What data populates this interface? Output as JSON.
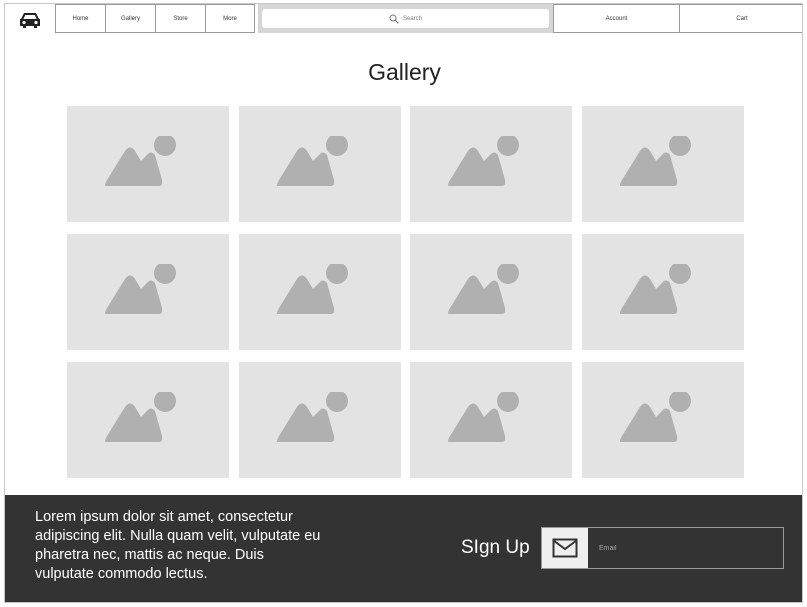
{
  "header": {
    "logo_icon": "car-icon",
    "nav": [
      {
        "label": "Home"
      },
      {
        "label": "Gallery"
      },
      {
        "label": "Store"
      },
      {
        "label": "More"
      }
    ],
    "search": {
      "placeholder": "Search",
      "icon": "search-icon"
    },
    "account_label": "Account",
    "cart_label": "Cart"
  },
  "main": {
    "title": "Gallery",
    "gallery_tile_count": 12,
    "tile_icon": "image-placeholder-icon"
  },
  "footer": {
    "text": "Lorem ipsum dolor sit amet, consectetur adipiscing elit. Nulla quam velit, vulputate eu pharetra nec, mattis ac neque. Duis vulputate commodo lectus.",
    "signup_label": "SIgn Up",
    "email": {
      "placeholder": "Email",
      "icon": "mail-icon"
    }
  },
  "colors": {
    "footer_bg": "#333333",
    "tile_bg": "#e3e3e3",
    "tile_icon": "#b0b0b0"
  }
}
